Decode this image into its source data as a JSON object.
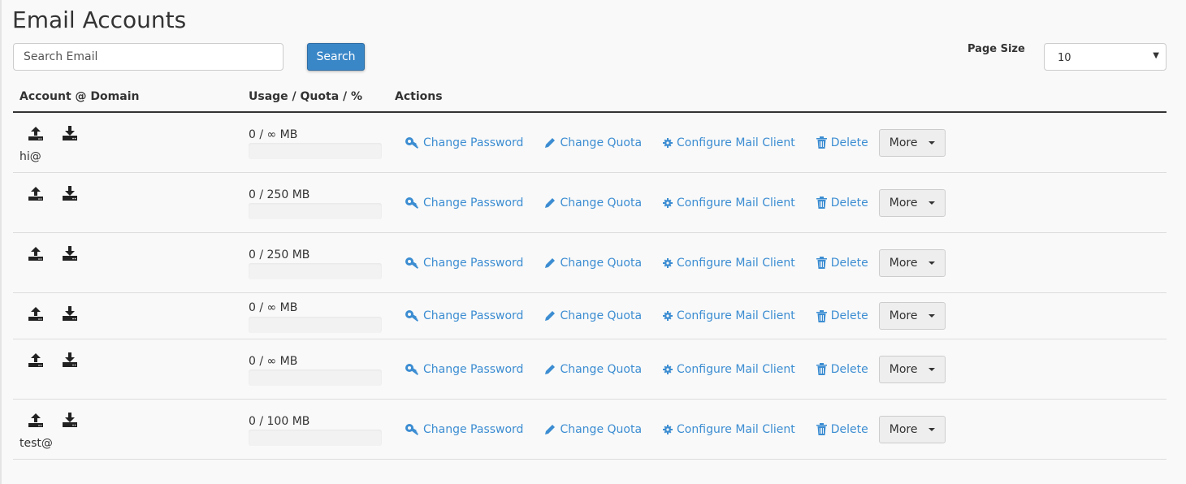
{
  "title": "Email Accounts",
  "search": {
    "placeholder": "Search Email",
    "button": "Search"
  },
  "page_size": {
    "label": "Page Size",
    "value": "10"
  },
  "columns": [
    "Account @ Domain",
    "Usage / Quota / %",
    "Actions"
  ],
  "action_labels": {
    "change_password": "Change Password",
    "change_quota": "Change Quota",
    "configure": "Configure Mail Client",
    "delete": "Delete",
    "more": "More"
  },
  "rows": [
    {
      "account": "hi@",
      "usage": "0 / ∞ MB",
      "percent": 0
    },
    {
      "account": "",
      "usage": "0 / 250 MB",
      "percent": 0
    },
    {
      "account": "",
      "usage": "0 / 250 MB",
      "percent": 0
    },
    {
      "account": "",
      "usage": "0 / ∞ MB",
      "percent": 0
    },
    {
      "account": "",
      "usage": "0 / ∞ MB",
      "percent": 0
    },
    {
      "account": "test@",
      "usage": "0 / 100 MB",
      "percent": 0
    }
  ],
  "colors": {
    "link": "#3c8dd2",
    "primary": "#3a87c8"
  }
}
